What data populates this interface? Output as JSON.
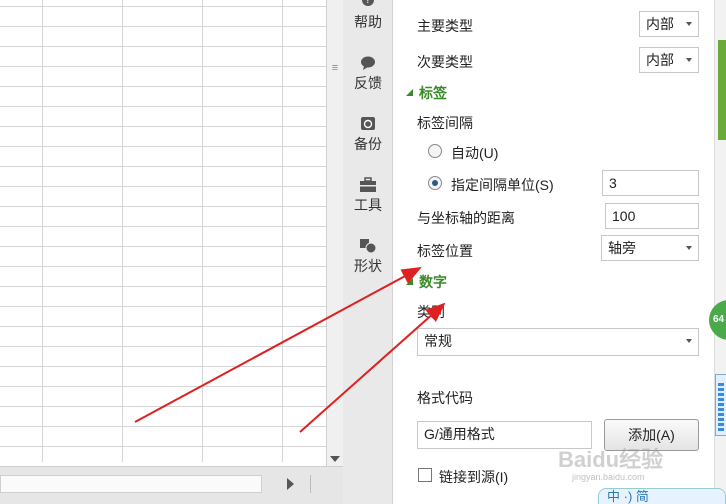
{
  "side_tools": [
    {
      "label": "帮助",
      "icon": "help-icon"
    },
    {
      "label": "反馈",
      "icon": "feedback-icon"
    },
    {
      "label": "备份",
      "icon": "backup-icon"
    },
    {
      "label": "工具",
      "icon": "toolbox-icon"
    },
    {
      "label": "形状",
      "icon": "shape-icon"
    }
  ],
  "panel": {
    "major_type": {
      "label": "主要类型",
      "value": "内部"
    },
    "minor_type": {
      "label": "次要类型",
      "value": "内部"
    },
    "labels_section": "标签",
    "label_interval": "标签间隔",
    "auto_option": "自动(U)",
    "specify_option": "指定间隔单位(S)",
    "specify_value": "3",
    "axis_distance": {
      "label": "与坐标轴的距离",
      "value": "100"
    },
    "label_position": {
      "label": "标签位置",
      "value": "轴旁"
    },
    "number_section": "数字",
    "category_label": "类别",
    "category_value": "常规",
    "format_code_label": "格式代码",
    "format_code_value": "G/通用格式",
    "add_button": "添加(A)",
    "link_source": "链接到源(I)"
  },
  "edge": {
    "badge": "64"
  },
  "watermark": {
    "text": "Baidu经验",
    "url": "jingyan.baidu.com"
  },
  "ime": {
    "text": "中 ·) 简"
  },
  "colors": {
    "section_green": "#3a8a2a",
    "annotation_red": "#e02020",
    "radio_selected": "#2a5a8a"
  }
}
